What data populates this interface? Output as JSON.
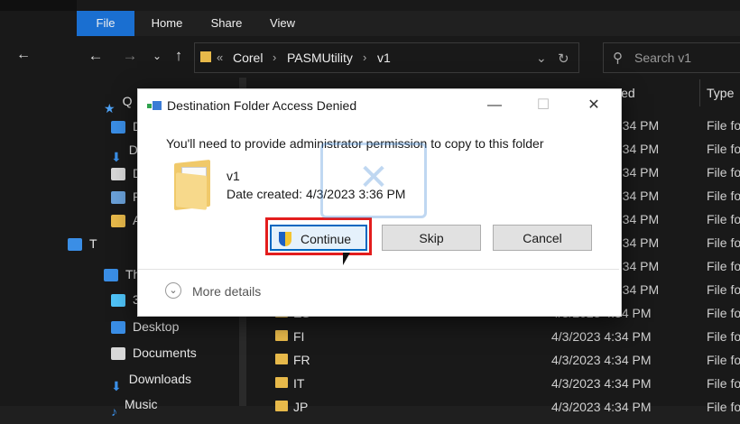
{
  "ribbon": {
    "tabs": [
      "File",
      "Home",
      "Share",
      "View"
    ]
  },
  "address": {
    "crumbs": [
      "Corel",
      "PASMUtility",
      "v1"
    ],
    "search_placeholder": "Search v1"
  },
  "navpane": {
    "items": [
      {
        "label": "Q",
        "icon": "star-icon"
      },
      {
        "label": "D",
        "icon": "desktop-icon"
      },
      {
        "label": "D",
        "icon": "download-icon"
      },
      {
        "label": "D",
        "icon": "document-icon"
      },
      {
        "label": "P",
        "icon": "picture-icon"
      },
      {
        "label": "A",
        "icon": "folder-icon"
      },
      {
        "label": "T",
        "icon": "pc-icon"
      },
      {
        "label": "Th",
        "icon": "pc-icon"
      },
      {
        "label": "3",
        "icon": "cube-icon"
      },
      {
        "label": "Desktop",
        "icon": "desktop-icon"
      },
      {
        "label": "Documents",
        "icon": "document-icon"
      },
      {
        "label": "Downloads",
        "icon": "download-icon"
      },
      {
        "label": "Music",
        "icon": "music-icon"
      }
    ]
  },
  "columns": {
    "modified": "ied",
    "type": "Type"
  },
  "files": [
    {
      "name": "",
      "date": "4:34 PM",
      "type": "File fo"
    },
    {
      "name": "",
      "date": "4:34 PM",
      "type": "File fo"
    },
    {
      "name": "",
      "date": "4:34 PM",
      "type": "File fo"
    },
    {
      "name": "",
      "date": "4:34 PM",
      "type": "File fo"
    },
    {
      "name": "",
      "date": "4:34 PM",
      "type": "File fo"
    },
    {
      "name": "",
      "date": "4:34 PM",
      "type": "File fo"
    },
    {
      "name": "",
      "date": "4:34 PM",
      "type": "File fo"
    },
    {
      "name": "",
      "date": "4:34 PM",
      "type": "File fo"
    },
    {
      "name": "ES",
      "date": "4/3/2023 4:34 PM",
      "type": "File fo"
    },
    {
      "name": "FI",
      "date": "4/3/2023 4:34 PM",
      "type": "File fo"
    },
    {
      "name": "FR",
      "date": "4/3/2023 4:34 PM",
      "type": "File fo"
    },
    {
      "name": "IT",
      "date": "4/3/2023 4:34 PM",
      "type": "File fo"
    },
    {
      "name": "JP",
      "date": "4/3/2023 4:34 PM",
      "type": "File fo"
    }
  ],
  "dialog": {
    "title": "Destination Folder Access Denied",
    "message": "You'll need to provide administrator permission to copy to this folder",
    "item_name": "v1",
    "item_date": "Date created: 4/3/2023 3:36 PM",
    "continue_label": "Continue",
    "skip_label": "Skip",
    "cancel_label": "Cancel",
    "more_details": "More details",
    "close_glyph": "✕",
    "minimize_glyph": "—",
    "maximize_glyph": "☐"
  },
  "colors": {
    "accent": "#1a6fd1",
    "highlight": "#e31d1d",
    "folder": "#e7b94a"
  }
}
